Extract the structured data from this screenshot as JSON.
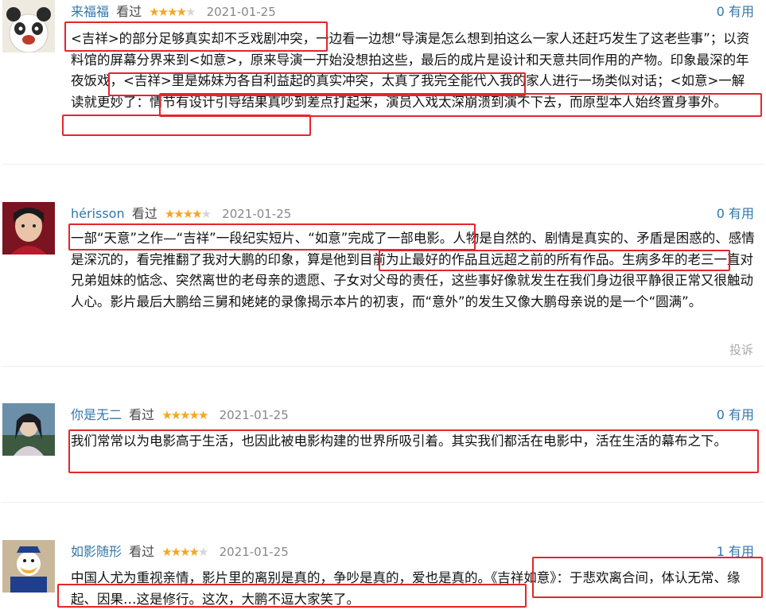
{
  "accent_color": "#3377aa",
  "highlight_color": "#e5262a",
  "star_color": "#f5a623",
  "reviews": [
    {
      "author": "来福福",
      "status": "看过",
      "stars": 4,
      "date": "2021-01-25",
      "votes": "0 有用",
      "content": "<吉祥>的部分足够真实却不乏戏剧冲突，一边看一边想“导演是怎么想到拍这么一家人还赶巧发生了这老些事”；以资料馆的屏幕分界来到<如意>，原来导演一开始没想拍这些，最后的成片是设计和天意共同作用的产物。印象最深的年夜饭戏，<吉祥>里是姊妹为各自利益起的真实冲突，太真了我完全能代入我的家人进行一场类似对话；<如意>一解读就更妙了：情节有设计引导结果真吵到差点打起来，演员入戏太深崩溃到演不下去，而原型本人始终置身事外。"
    },
    {
      "author": "hérisson",
      "status": "看过",
      "stars": 4,
      "date": "2021-01-25",
      "votes": "0 有用",
      "report": "投诉",
      "content": "一部“天意”之作—“吉祥”一段纪实短片、“如意”完成了一部电影。人物是自然的、剧情是真实的、矛盾是困惑的、感情是深沉的，看完推翻了我对大鹏的印象，算是他到目前为止最好的作品且远超之前的所有作品。生病多年的老三一直对兄弟姐妹的惦念、突然离世的老母亲的遗愿、子女对父母的责任，这些事好像就发生在我们身边很平静很正常又很触动人心。影片最后大鹏给三舅和姥姥的录像揭示本片的初衷，而“意外”的发生又像大鹏母亲说的是一个“圆满”。"
    },
    {
      "author": "你是无二",
      "status": "看过",
      "stars": 5,
      "date": "2021-01-25",
      "votes": "0 有用",
      "content": "我们常常以为电影高于生活，也因此被电影构建的世界所吸引着。其实我们都活在电影中，活在生活的幕布之下。"
    },
    {
      "author": "如影随形",
      "status": "看过",
      "stars": 4,
      "date": "2021-01-25",
      "votes": "1 有用",
      "content": "中国人尤为重视亲情，影片里的离别是真的，争吵是真的，爱也是真的。《吉祥如意》：于悲欢离合间，体认无常、缘起、因果…这是修行。这次，大鹏不逗大家笑了。"
    }
  ]
}
